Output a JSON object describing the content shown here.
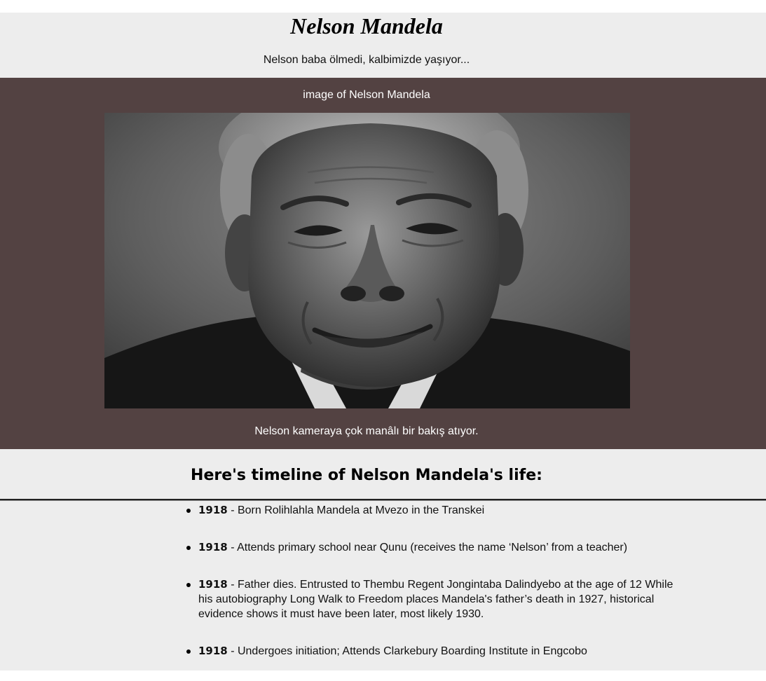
{
  "header": {
    "title": "Nelson Mandela",
    "tagline": "Nelson baba ölmedi, kalbimizde yaşıyor..."
  },
  "image_section": {
    "label": "image of Nelson Mandela",
    "caption": "Nelson kameraya çok manâlı bir bakış atıyor.",
    "background": "#534242"
  },
  "timeline": {
    "heading": "Here's timeline of Nelson Mandela's life:",
    "items": [
      {
        "year": "1918",
        "text": " - Born Rolihlahla Mandela at Mvezo in the Transkei"
      },
      {
        "year": "1918",
        "text": " - Attends primary school near Qunu (receives the name ‘Nelson’ from a teacher)"
      },
      {
        "year": "1918",
        "text": " - Father dies. Entrusted to Thembu Regent Jongintaba Dalindyebo at the age of 12 While his autobiography Long Walk to Freedom places Mandela's father’s death in 1927, historical evidence shows it must have been later, most likely 1930."
      },
      {
        "year": "1918",
        "text": " - Undergoes initiation; Attends Clarkebury Boarding Institute in Engcobo"
      }
    ]
  }
}
